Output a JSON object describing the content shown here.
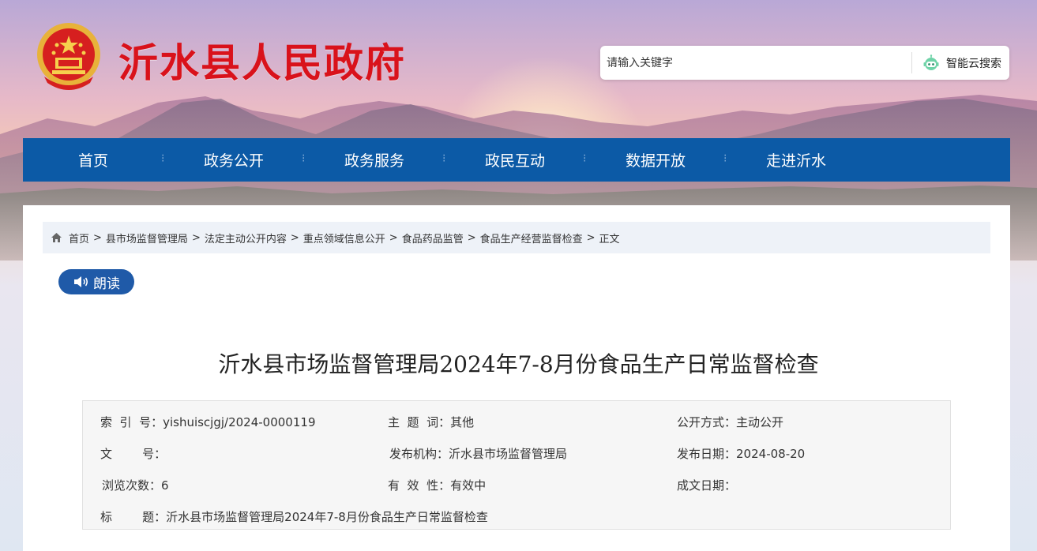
{
  "header": {
    "site_title": "沂水县人民政府",
    "search_placeholder": "请输入关键字",
    "search_button_label": "智能云搜索"
  },
  "nav": {
    "items": [
      "首页",
      "政务公开",
      "政务服务",
      "政民互动",
      "数据开放",
      "走进沂水"
    ],
    "separator": "⁝"
  },
  "breadcrumb": {
    "items": [
      "首页",
      "县市场监督管理局",
      "法定主动公开内容",
      "重点领域信息公开",
      "食品药品监管",
      "食品生产经营监督检查"
    ],
    "separator": ">",
    "current": "正文"
  },
  "read_button_label": "朗读",
  "document": {
    "title": "沂水县市场监督管理局2024年7-8月份食品生产日常监督检查",
    "meta": {
      "index_label": "索  引  号：",
      "index_value": "yishuiscjgj/2024-0000119",
      "topic_label": "主  题  词：",
      "topic_value": "其他",
      "open_mode_label": "公开方式：",
      "open_mode_value": "主动公开",
      "doc_no_label": "文        号：",
      "doc_no_value": "",
      "publisher_label": "发布机构：",
      "publisher_value": "沂水县市场监督管理局",
      "publish_date_label": "发布日期：",
      "publish_date_value": "2024-08-20",
      "views_label": "浏览次数：",
      "views_value": "6",
      "validity_label": "有  效  性：",
      "validity_value": "有效中",
      "written_date_label": "成文日期：",
      "written_date_value": "",
      "title_label": "标        题：",
      "title_value": "沂水县市场监督管理局2024年7-8月份食品生产日常监督检查"
    }
  },
  "colors": {
    "title_red": "#d9121b",
    "nav_blue": "#0c5aa6",
    "button_blue": "#1f5aa8"
  }
}
